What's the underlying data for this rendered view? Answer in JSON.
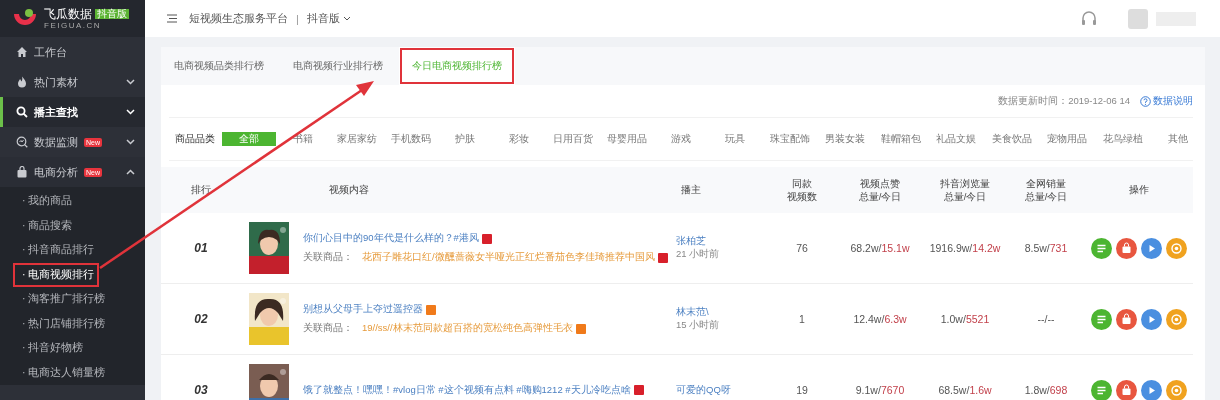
{
  "logo": {
    "name": "飞瓜数据",
    "badge": "抖音版",
    "domain": "FEIGUA.CN"
  },
  "sidebar": {
    "items": [
      {
        "label": "工作台",
        "selected": false,
        "has_caret": false,
        "annotated": false
      },
      {
        "label": "热门素材",
        "selected": false,
        "expanded": false,
        "has_caret": true,
        "annotated": false
      },
      {
        "label": "播主查找",
        "selected": true,
        "expanded": false,
        "has_caret": true,
        "annotated": false
      },
      {
        "label": "数据监测",
        "badge": "New",
        "selected": false,
        "expanded": false,
        "has_caret": true,
        "annotated": false
      },
      {
        "label": "电商分析",
        "badge": "New",
        "selected": false,
        "expanded": true,
        "has_caret": true,
        "annotated": false,
        "children": [
          {
            "label": "· 我的商品",
            "selected": false,
            "annotated": false
          },
          {
            "label": "· 商品搜索",
            "selected": false,
            "annotated": false
          },
          {
            "label": "· 抖音商品排行",
            "selected": false,
            "annotated": false
          },
          {
            "label": "· 电商视频排行",
            "selected": true,
            "annotated": true
          },
          {
            "label": "· 淘客推广排行榜",
            "selected": false,
            "annotated": false
          },
          {
            "label": "· 热门店铺排行榜",
            "selected": false,
            "annotated": false
          },
          {
            "label": "· 抖音好物榜",
            "selected": false,
            "annotated": false
          },
          {
            "label": "· 电商达人销量榜",
            "selected": false,
            "annotated": false
          }
        ]
      }
    ]
  },
  "header": {
    "platform": "短视频生态服务平台",
    "separator": "|",
    "version": "抖音版"
  },
  "tabs": [
    {
      "label": "电商视频品类排行榜",
      "selected": false,
      "annotated": false
    },
    {
      "label": "电商视频行业排行榜",
      "selected": false,
      "annotated": false
    },
    {
      "label": "今日电商视频排行榜",
      "selected": true,
      "annotated": true
    }
  ],
  "update": {
    "text": "数据更新时间：2019-12-06 14",
    "help": "数据说明"
  },
  "categories": {
    "label": "商品品类",
    "items": [
      {
        "label": "全部",
        "selected": true
      },
      {
        "label": "书籍",
        "selected": false
      },
      {
        "label": "家居家纺",
        "selected": false
      },
      {
        "label": "手机数码",
        "selected": false
      },
      {
        "label": "护肤",
        "selected": false
      },
      {
        "label": "彩妆",
        "selected": false
      },
      {
        "label": "日用百货",
        "selected": false
      },
      {
        "label": "母婴用品",
        "selected": false
      },
      {
        "label": "游戏",
        "selected": false
      },
      {
        "label": "玩具",
        "selected": false
      },
      {
        "label": "珠宝配饰",
        "selected": false
      },
      {
        "label": "男装女装",
        "selected": false
      },
      {
        "label": "鞋帽箱包",
        "selected": false
      },
      {
        "label": "礼品文娱",
        "selected": false
      },
      {
        "label": "美食饮品",
        "selected": false
      },
      {
        "label": "宠物用品",
        "selected": false
      },
      {
        "label": "花鸟绿植",
        "selected": false
      },
      {
        "label": "其他",
        "selected": false
      }
    ]
  },
  "table": {
    "columns": [
      {
        "label": "排行"
      },
      {
        "label": "视频内容"
      },
      {
        "label": "播主"
      },
      {
        "label": "同款",
        "label2": "视频数"
      },
      {
        "label": "视频点赞",
        "label2": "总量/今日"
      },
      {
        "label": "抖音浏览量",
        "label2": "总量/今日"
      },
      {
        "label": "全网销量",
        "label2": "总量/今日"
      },
      {
        "label": "操作"
      }
    ],
    "rows": [
      {
        "rank": "01",
        "title": "你们心目中的90年代是什么样的？#港风",
        "title_badge": {
          "color": "#d8202b"
        },
        "product_label": "关联商品：",
        "product": "花西子雕花口红/微醺蔷薇女半哑光正红烂番茄色李佳琦推荐中国风",
        "product_badge": {
          "color": "#d8202b"
        },
        "author": "张柏芝",
        "time": "21 小时前",
        "same": "76",
        "likes": {
          "total": "68.2w/",
          "today": "15.1w"
        },
        "views": {
          "total": "1916.9w/",
          "today": "14.2w"
        },
        "sales": {
          "total": "8.5w/",
          "today": "731"
        }
      },
      {
        "rank": "02",
        "title": "别想从父母手上夺过遥控器",
        "title_badge": {
          "color": "#f07a1a"
        },
        "product_label": "关联商品：",
        "product": "19//ss//林末范同款超百搭的宽松纯色高弹性毛衣",
        "product_badge": {
          "color": "#f07a1a"
        },
        "author": "林末范\\",
        "time": "15 小时前",
        "same": "1",
        "likes": {
          "total": "12.4w/",
          "today": "6.3w"
        },
        "views": {
          "total": "1.0w/",
          "today": "5521"
        },
        "sales": {
          "total": "--/--"
        }
      },
      {
        "rank": "03",
        "title": "饿了就整点！嘿嘿！#vlog日常 #这个视频有点料 #嗨购1212 #天儿冷吃点啥",
        "title_badge": {
          "color": "#d8202b"
        },
        "author": "可爱的QQ呀",
        "same": "19",
        "likes": {
          "total": "9.1w/",
          "today": "7670"
        },
        "views": {
          "total": "68.5w/",
          "today": "1.6w"
        },
        "sales": {
          "total": "1.8w/",
          "today": "698"
        }
      }
    ]
  }
}
